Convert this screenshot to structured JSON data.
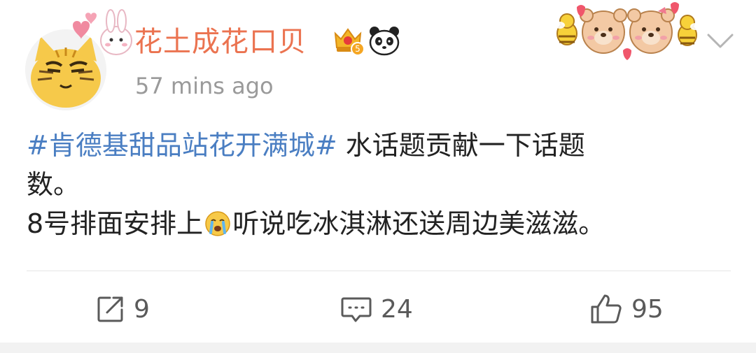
{
  "post": {
    "username": "花土成花口贝",
    "timestamp": "57 mins ago",
    "vip_level": "5",
    "hashtag": "#肯德基甜品站花开满城#",
    "line1_text": " 水话题贡献一下话题",
    "line2_text": "数。",
    "line3_before_emoji": "8号排面安排上",
    "line3_after_emoji": "听说吃冰淇淋还送周边美滋滋。",
    "inline_emoji": "crying-face-emoji"
  },
  "actions": {
    "repost_count": "9",
    "comment_count": "24",
    "like_count": "95"
  },
  "icons": {
    "repost": "repost-icon",
    "comment": "comment-icon",
    "like": "thumbs-up-icon",
    "more": "chevron-down-icon",
    "vip": "crown-badge-icon",
    "panda": "panda-icon"
  },
  "colors": {
    "username": "#eb7350",
    "hashtag": "#4a7ec2",
    "text": "#222222",
    "meta": "#9a9a9a"
  }
}
